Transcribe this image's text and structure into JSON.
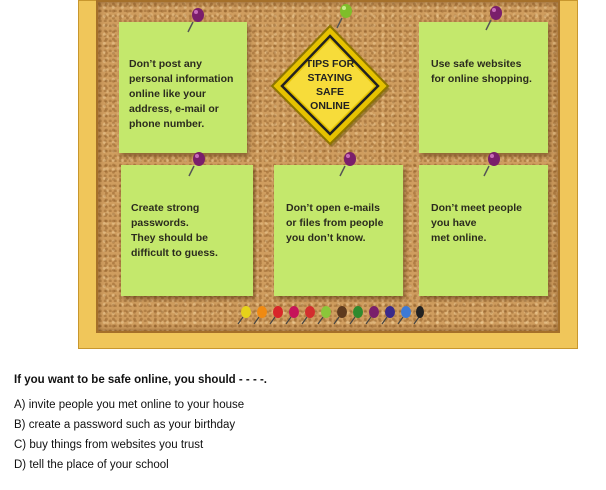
{
  "notes": {
    "top_left": "Don’t post any\npersonal information\nonline like your\naddress, e-mail or\nphone number.",
    "top_right": "Use safe websites\nfor online shopping.",
    "bottom_left": "Create strong\npasswords.\nThey should be\ndifficult to guess.",
    "bottom_middle": "Don’t open e-mails\nor files from people\nyou don’t know.",
    "bottom_right": "Don’t meet people\nyou have\nmet online."
  },
  "sign": {
    "text": "TIPS FOR\nSTAYING\nSAFE\nONLINE"
  },
  "colors": {
    "note": "#c4e86c",
    "sign": "#f5d21c",
    "frame": "#f0c65a",
    "cork": "#cf9d5f",
    "pin": "#7a1e6b"
  },
  "icons": {
    "pin": "push-pin",
    "tacks": "thumbtack-row"
  },
  "quiz": {
    "question": "If you want to be safe online, you should - - - -.",
    "options": [
      "A) invite people you met online to your house",
      "B) create a password such as your birthday",
      "C) buy things from websites you trust",
      "D) tell the place of your school"
    ]
  }
}
